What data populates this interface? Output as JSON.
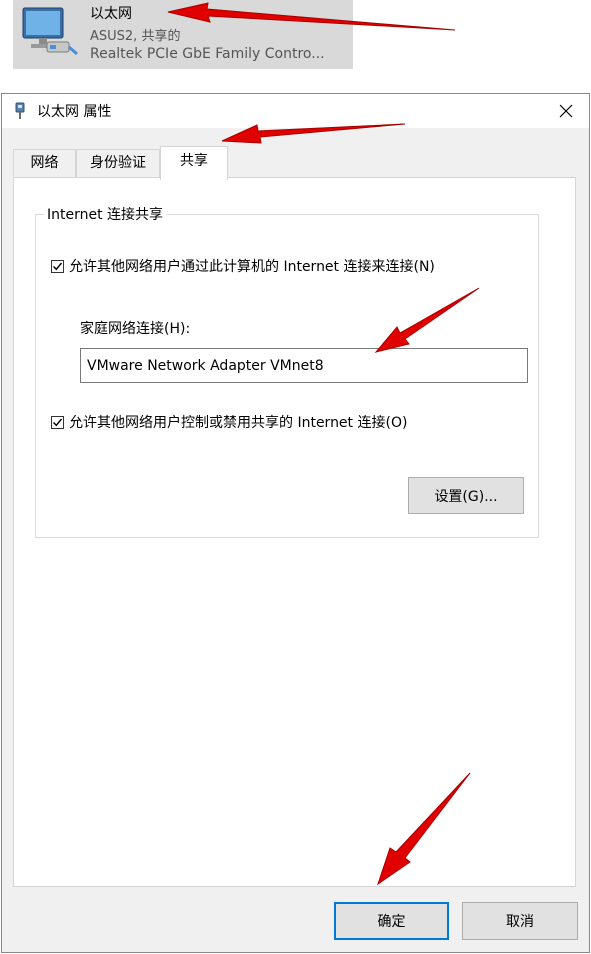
{
  "adapter": {
    "name": "以太网",
    "status": "ASUS2, 共享的",
    "device": "Realtek PCIe GbE Family Contro...",
    "icon": "network-adapter-icon"
  },
  "dialog": {
    "title": "以太网 属性",
    "title_icon": "ethernet-plug-icon",
    "close_label": "✕",
    "tabs": [
      {
        "label": "网络"
      },
      {
        "label": "身份验证"
      },
      {
        "label": "共享",
        "active": true
      }
    ],
    "sharing": {
      "group_title": "Internet 连接共享",
      "allow_connect_label": "允许其他网络用户通过此计算机的 Internet 连接来连接(N)",
      "allow_connect_checked": true,
      "home_label": "家庭网络连接(H):",
      "home_value": "VMware Network Adapter VMnet8",
      "allow_control_label": "允许其他网络用户控制或禁用共享的 Internet 连接(O)",
      "allow_control_checked": true,
      "settings_label": "设置(G)..."
    },
    "ok_label": "确定",
    "cancel_label": "取消"
  },
  "annotation_color": "#e00000",
  "focus_color": "#0078d7"
}
